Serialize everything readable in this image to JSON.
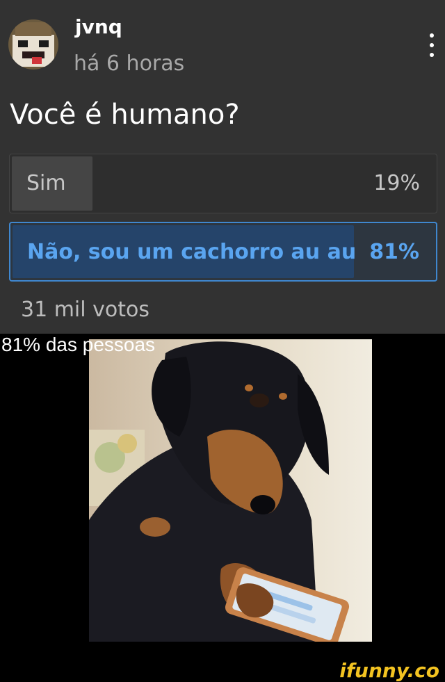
{
  "post": {
    "username": "jvnq",
    "time": "há 6 horas",
    "question": "Você é humano?",
    "options": [
      {
        "label": "Sim",
        "percent_text": "19%",
        "percent": 19
      },
      {
        "label": "Não, sou um cachorro au au",
        "percent_text": "81%",
        "percent": 81
      }
    ],
    "votes": "31 mil votos"
  },
  "caption": "81% das pessoas",
  "watermark": "ifunny.co",
  "icons": {
    "menu": "more-vertical-icon",
    "avatar": "pixel-face-avatar"
  },
  "colors": {
    "card_bg": "#323232",
    "selected_border": "#3f87cf",
    "selected_text": "#5aa5f0",
    "watermark": "#f3c321"
  }
}
